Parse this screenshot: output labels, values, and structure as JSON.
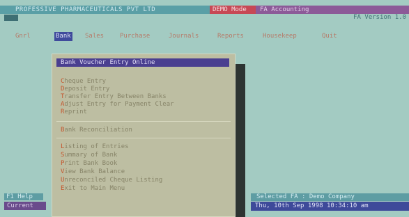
{
  "topbar": {
    "company": "PROFESSIVE PHARMACEUTICALS PVT LTD",
    "badge": "DEMO Mode",
    "app_title": "FA Accounting"
  },
  "row2": {
    "mark": "",
    "version": "FA Version 1.0"
  },
  "menu": [
    {
      "label": "Gnrl",
      "active": false
    },
    {
      "label": "Bank",
      "active": true
    },
    {
      "label": "Sales",
      "active": false
    },
    {
      "label": "Purchase",
      "active": false
    },
    {
      "label": "Journals",
      "active": false
    },
    {
      "label": "Reports",
      "active": false
    },
    {
      "label": "Housekeep",
      "active": false
    },
    {
      "label": "Quit",
      "active": false
    }
  ],
  "dialog": {
    "title": "Bank Voucher Entry  Online",
    "group1": [
      {
        "hot": "C",
        "rest": "heque Entry"
      },
      {
        "hot": "D",
        "rest": "eposit Entry"
      },
      {
        "hot": "T",
        "rest": "ransfer Entry Between Banks"
      },
      {
        "hot": "A",
        "rest": "djust Entry for Payment Clear"
      },
      {
        "hot": "R",
        "rest": "eprint"
      }
    ],
    "group2": [
      {
        "hot": "B",
        "rest": "ank Reconciliation"
      }
    ],
    "group3": [
      {
        "hot": "L",
        "rest": "isting of Entries"
      },
      {
        "hot": "S",
        "rest": "ummary of Bank"
      },
      {
        "hot": "P",
        "rest": "rint Bank Book"
      },
      {
        "hot": "V",
        "rest": "iew Bank Balance"
      },
      {
        "hot": "U",
        "rest": "nreconciled Cheque Listing"
      },
      {
        "hot": "E",
        "rest": "xit to Main Menu"
      }
    ]
  },
  "status": {
    "left_top": "F1 Help",
    "left_bottom": "Current",
    "right_top": "Selected FA : Demo Company",
    "right_bottom": "Thu, 10th Sep 1998  10:34:10 am"
  }
}
